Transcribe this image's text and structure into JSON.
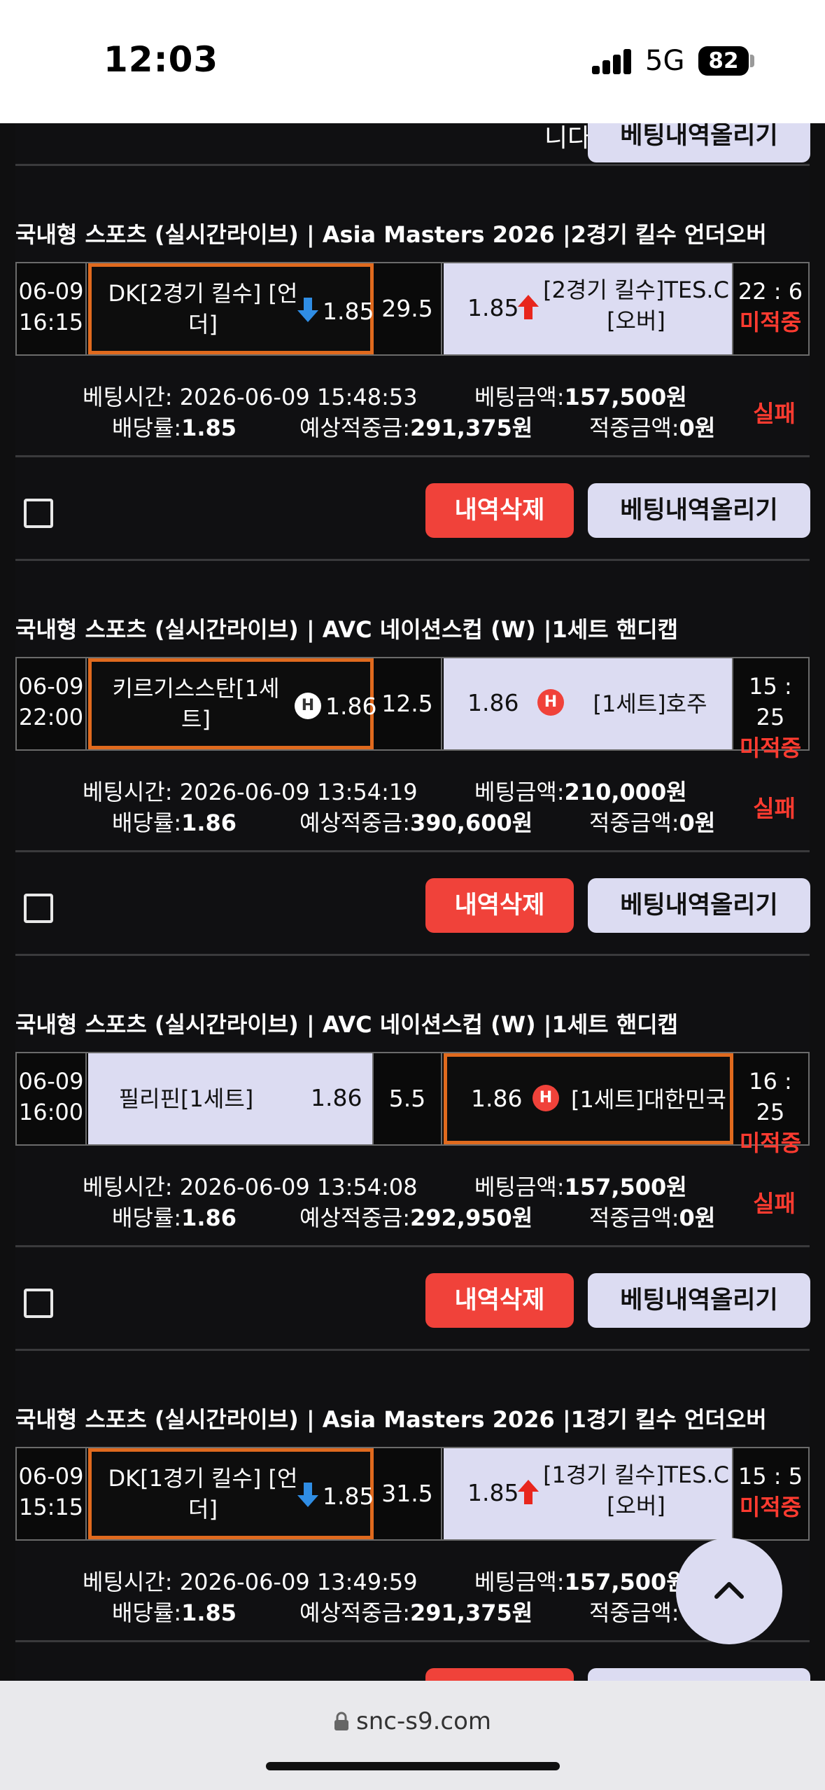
{
  "status": {
    "time": "12:03",
    "network": "5G",
    "battery": "82"
  },
  "browser": {
    "url": "snc-s9.com"
  },
  "top_partial": {
    "clipped_text": "니다",
    "upload_label": "베팅내역올리기"
  },
  "buttons": {
    "delete": "내역삭제",
    "upload": "베팅내역올리기"
  },
  "labels": {
    "bet_time": "베팅시간: ",
    "bet_amount": "베팅금액:",
    "odds_rate": "배당률:",
    "expected_win": "예상적중금:",
    "hit_amount": "적중금액:"
  },
  "bets": [
    {
      "title": "국내형 스포츠 (실시간라이브) | Asia Masters 2026  |2경기 킬수 언더오버",
      "date": "06-09",
      "time": "16:15",
      "home": {
        "name": "DK[2경기 킬수] [언더]",
        "odds": "1.85",
        "indicator": "down"
      },
      "line": "29.5",
      "away": {
        "name": "[2경기 킬수]TES.C [오버]",
        "odds": "1.85",
        "indicator": "up"
      },
      "score": "22 : 6",
      "state": "미적중",
      "bet_time": "2026-06-09 15:48:53",
      "bet_amount": "157,500원",
      "odds_rate": "1.85",
      "expected_win": "291,375원",
      "hit_amount": "0원",
      "result": "실패"
    },
    {
      "title": "국내형 스포츠 (실시간라이브) | AVC 네이션스컵 (W)  |1세트 핸디캡",
      "date": "06-09",
      "time": "22:00",
      "home": {
        "name": "키르기스스탄[1세트]",
        "odds": "1.86",
        "indicator": "H"
      },
      "line": "12.5",
      "away": {
        "name": "[1세트]호주",
        "odds": "1.86",
        "indicator": "H"
      },
      "score": "15 : 25",
      "state": "미적중",
      "bet_time": "2026-06-09 13:54:19",
      "bet_amount": "210,000원",
      "odds_rate": "1.86",
      "expected_win": "390,600원",
      "hit_amount": "0원",
      "result": "실패"
    },
    {
      "title": "국내형 스포츠 (실시간라이브) | AVC 네이션스컵 (W)  |1세트 핸디캡",
      "date": "06-09",
      "time": "16:00",
      "home": {
        "name": "필리핀[1세트]",
        "odds": "1.86",
        "indicator": ""
      },
      "line": "5.5",
      "away": {
        "name": "[1세트]대한민국",
        "odds": "1.86",
        "indicator": "H"
      },
      "score": "16 : 25",
      "state": "미적중",
      "bet_time": "2026-06-09 13:54:08",
      "bet_amount": "157,500원",
      "odds_rate": "1.86",
      "expected_win": "292,950원",
      "hit_amount": "0원",
      "result": "실패"
    },
    {
      "title": "국내형 스포츠 (실시간라이브) | Asia Masters 2026  |1경기 킬수 언더오버",
      "date": "06-09",
      "time": "15:15",
      "home": {
        "name": "DK[1경기 킬수] [언더]",
        "odds": "1.85",
        "indicator": "down"
      },
      "line": "31.5",
      "away": {
        "name": "[1경기 킬수]TES.C [오버]",
        "odds": "1.85",
        "indicator": "up"
      },
      "score": "15 : 5",
      "state": "미적중",
      "bet_time": "2026-06-09 13:49:59",
      "bet_amount": "157,500원",
      "odds_rate": "1.85",
      "expected_win": "291,375원",
      "hit_amount": "",
      "result": ""
    }
  ],
  "colors": {
    "selected_border": "#e06a1e",
    "delete_button": "#f0423a",
    "fail_red": "#ff3b30",
    "light_cell": "#dcdcf2"
  }
}
